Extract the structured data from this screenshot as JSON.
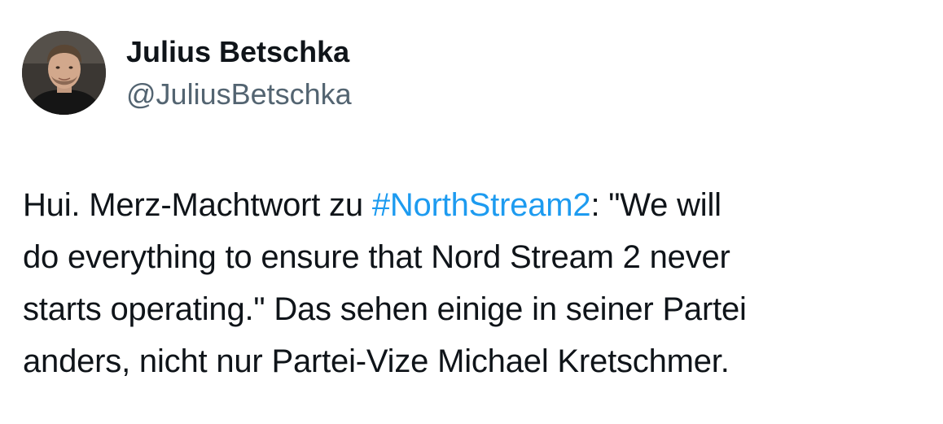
{
  "author": {
    "name": "Julius Betschka",
    "handle": "@JuliusBetschka",
    "avatar_icon": "profile-photo"
  },
  "tweet": {
    "line1_pre": "Hui. Merz-Machtwort zu ",
    "hashtag": "#NorthStream2",
    "line1_post": ": \"We will",
    "line2": "do everything to ensure that Nord Stream 2 never",
    "line3": "starts operating.\" Das sehen einige in seiner Partei",
    "line4": "anders, nicht nur Partei-Vize Michael Kretschmer."
  },
  "colors": {
    "text": "#0f1419",
    "handle": "#536471",
    "hashtag": "#1d9bf0"
  }
}
